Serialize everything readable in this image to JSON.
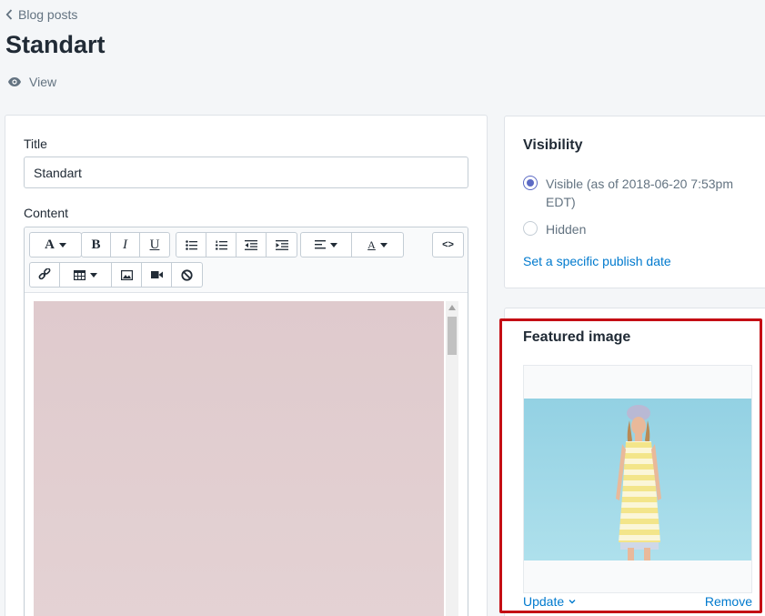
{
  "breadcrumb": {
    "label": "Blog posts"
  },
  "page": {
    "title": "Standart",
    "view_label": "View"
  },
  "form": {
    "title_label": "Title",
    "title_value": "Standart",
    "content_label": "Content",
    "toolbar": {
      "bold": "B",
      "italic": "I",
      "underline": "U",
      "font_icon": "A",
      "color_icon": "A",
      "html_icon": "<>"
    }
  },
  "visibility": {
    "title": "Visibility",
    "visible_label": "Visible (as of 2018-06-20 7:53pm EDT)",
    "hidden_label": "Hidden",
    "selected": "visible",
    "publish_link": "Set a specific publish date"
  },
  "featured_image": {
    "title": "Featured image",
    "update_label": "Update",
    "remove_label": "Remove"
  },
  "colors": {
    "link": "#007ace",
    "radio_accent": "#5c6ac4",
    "highlight_border": "#c40e14"
  },
  "icons": [
    "chevron-left-icon",
    "eye-icon",
    "font-icon",
    "bold-icon",
    "italic-icon",
    "underline-icon",
    "bulleted-list-icon",
    "numbered-list-icon",
    "outdent-icon",
    "indent-icon",
    "align-left-icon",
    "text-color-icon",
    "html-code-icon",
    "link-icon",
    "table-icon",
    "image-icon",
    "video-icon",
    "clear-format-icon",
    "chevron-down-icon"
  ]
}
